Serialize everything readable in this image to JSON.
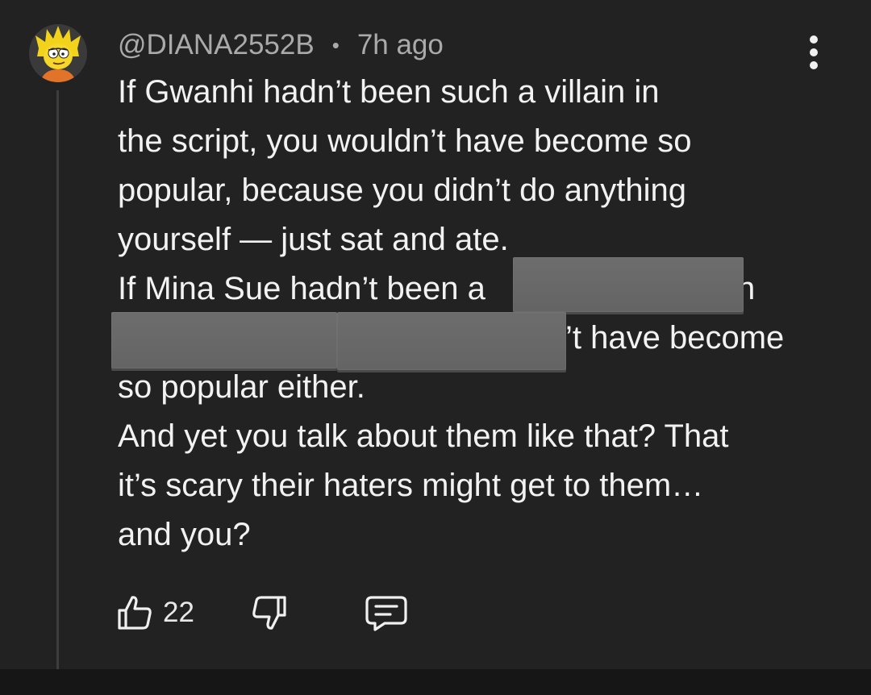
{
  "comment": {
    "username": "@DIANA2552B",
    "separator": "•",
    "timestamp": "7h ago",
    "lines": [
      "If Gwanhi hadn’t been such a villain in",
      "the script, you wouldn’t have become so",
      "popular, because you didn’t do anything",
      "yourself — just sat and ate.",
      "If Mina Sue hadn’t been a",
      "’t have become",
      "so popular either.",
      "And yet you talk about them like that? That",
      "it’s scary their haters might get to them…",
      "and you?"
    ],
    "line5_tail": "n",
    "redacted": true
  },
  "actions": {
    "like_count": "22",
    "like_icon": "thumbs-up-icon",
    "dislike_icon": "thumbs-down-icon",
    "reply_icon": "comment-icon"
  },
  "menu": {
    "icon": "more-vertical-icon"
  },
  "avatar": {
    "icon": "cartoon-avatar"
  },
  "colors": {
    "background": "#222222",
    "text": "#f2f2f2",
    "meta_text": "#aaaaaa",
    "redaction": "#676767",
    "thread_line": "#3d3d3d"
  }
}
